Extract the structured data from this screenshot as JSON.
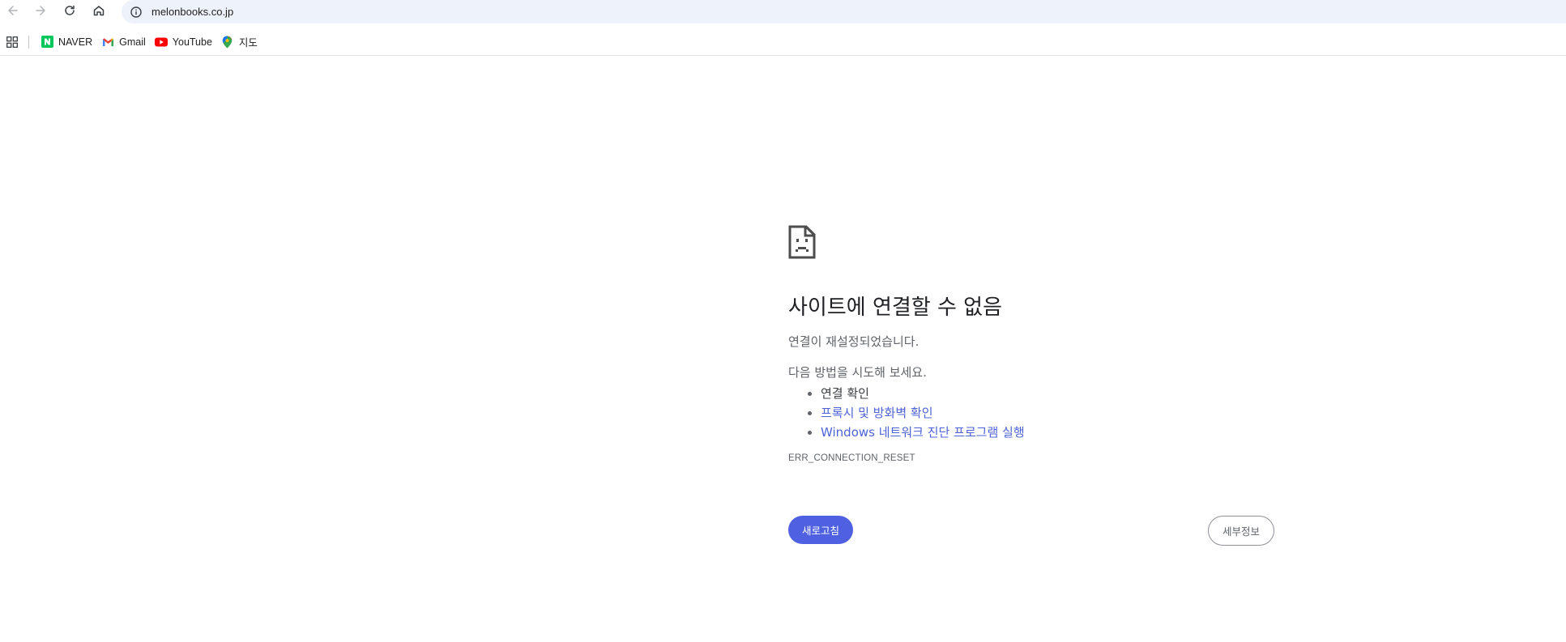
{
  "toolbar": {
    "url": "melonbooks.co.jp",
    "back_icon": "back-arrow-icon",
    "forward_icon": "forward-arrow-icon",
    "reload_icon": "reload-icon",
    "home_icon": "home-icon",
    "site_info_icon": "info-icon"
  },
  "bookmarks": {
    "items": [
      {
        "label": "NAVER",
        "icon": "naver-icon"
      },
      {
        "label": "Gmail",
        "icon": "gmail-icon"
      },
      {
        "label": "YouTube",
        "icon": "youtube-icon"
      },
      {
        "label": "지도",
        "icon": "maps-icon"
      }
    ]
  },
  "error": {
    "icon": "sad-page-icon",
    "title": "사이트에 연결할 수 없음",
    "subtitle": "연결이 재설정되었습니다.",
    "try_heading": "다음 방법을 시도해 보세요.",
    "suggestions": [
      "연결 확인",
      "프록시 및 방화벽 확인",
      "Windows 네트워크 진단 프로그램 실행"
    ],
    "code": "ERR_CONNECTION_RESET",
    "reload_label": "새로고침",
    "details_label": "세부정보"
  },
  "colors": {
    "accent": "#4f61e1",
    "link": "#4e63d8",
    "omnibox": "#eef2fa"
  }
}
